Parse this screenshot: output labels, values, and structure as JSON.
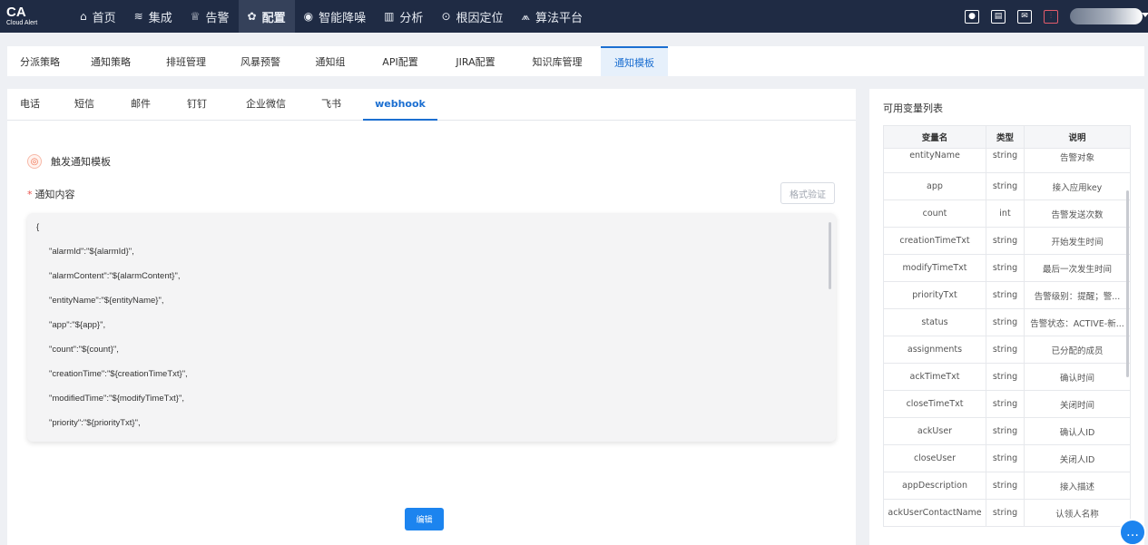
{
  "logo": {
    "text": "CA",
    "subtext": "Cloud Alert"
  },
  "nav": [
    {
      "label": "首页",
      "icon": "⌂",
      "icon_name": "home-icon",
      "active": false
    },
    {
      "label": "集成",
      "icon": "≋",
      "icon_name": "layers-icon",
      "active": false
    },
    {
      "label": "告警",
      "icon": "♕",
      "icon_name": "alarm-icon",
      "active": false
    },
    {
      "label": "配置",
      "icon": "✿",
      "icon_name": "settings-icon",
      "active": true
    },
    {
      "label": "智能降噪",
      "icon": "◉",
      "icon_name": "noise-icon",
      "active": false
    },
    {
      "label": "分析",
      "icon": "▥",
      "icon_name": "analytics-icon",
      "active": false
    },
    {
      "label": "根因定位",
      "icon": "⊙",
      "icon_name": "locate-icon",
      "active": false
    },
    {
      "label": "算法平台",
      "icon": "⩕",
      "icon_name": "algorithm-icon",
      "active": false
    }
  ],
  "top_icons": [
    {
      "name": "rocket-icon",
      "glyph": "●"
    },
    {
      "name": "layout-icon",
      "glyph": "▤"
    },
    {
      "name": "message-icon",
      "glyph": "✉"
    },
    {
      "name": "equalizer-icon",
      "glyph": "⫶"
    }
  ],
  "subtabs": [
    {
      "label": "分派策略",
      "active": false
    },
    {
      "label": "通知策略",
      "active": false
    },
    {
      "label": "排班管理",
      "active": false
    },
    {
      "label": "风暴预警",
      "active": false
    },
    {
      "label": "通知组",
      "active": false
    },
    {
      "label": "API配置",
      "active": false
    },
    {
      "label": "JIRA配置",
      "active": false
    },
    {
      "label": "知识库管理",
      "active": false
    },
    {
      "label": "通知模板",
      "active": true
    }
  ],
  "channels": [
    {
      "label": "电话",
      "active": false
    },
    {
      "label": "短信",
      "active": false
    },
    {
      "label": "邮件",
      "active": false
    },
    {
      "label": "钉钉",
      "active": false
    },
    {
      "label": "企业微信",
      "active": false
    },
    {
      "label": "飞书",
      "active": false
    },
    {
      "label": "webhook",
      "active": true
    }
  ],
  "template": {
    "title": "触发通知模板",
    "content_label": "通知内容",
    "required_mark": "*",
    "format_button": "格式验证",
    "code_lines": [
      "{",
      "\"alarmId\":\"${alarmId}\",",
      "\"alarmContent\":\"${alarmContent}\",",
      "\"entityName\":\"${entityName}\",",
      "\"app\":\"${app}\",",
      "\"count\":\"${count}\",",
      "\"creationTime\":\"${creationTimeTxt}\",",
      "\"modifiedTime\":\"${modifyTimeTxt}\",",
      "\"priority\":\"${priorityTxt}\","
    ],
    "edit_button": "编辑"
  },
  "variables": {
    "title": "可用变量列表",
    "headers": [
      "变量名",
      "类型",
      "说明"
    ],
    "rows": [
      [
        "entityName",
        "string",
        "告警对象"
      ],
      [
        "app",
        "string",
        "接入应用key"
      ],
      [
        "count",
        "int",
        "告警发送次数"
      ],
      [
        "creationTimeTxt",
        "string",
        "开始发生时间"
      ],
      [
        "modifyTimeTxt",
        "string",
        "最后一次发生时间"
      ],
      [
        "priorityTxt",
        "string",
        "告警级别：提醒；警..."
      ],
      [
        "status",
        "string",
        "告警状态：ACTIVE-新..."
      ],
      [
        "assignments",
        "string",
        "已分配的成员"
      ],
      [
        "ackTimeTxt",
        "string",
        "确认时间"
      ],
      [
        "closeTimeTxt",
        "string",
        "关闭时间"
      ],
      [
        "ackUser",
        "string",
        "确认人ID"
      ],
      [
        "closeUser",
        "string",
        "关闭人ID"
      ],
      [
        "appDescription",
        "string",
        "接入描述"
      ],
      [
        "ackUserContactName",
        "string",
        "认领人名称"
      ]
    ]
  },
  "colors": {
    "topbar": "#1f2b44",
    "accent": "#1c6fd1",
    "button": "#1c84ef"
  }
}
